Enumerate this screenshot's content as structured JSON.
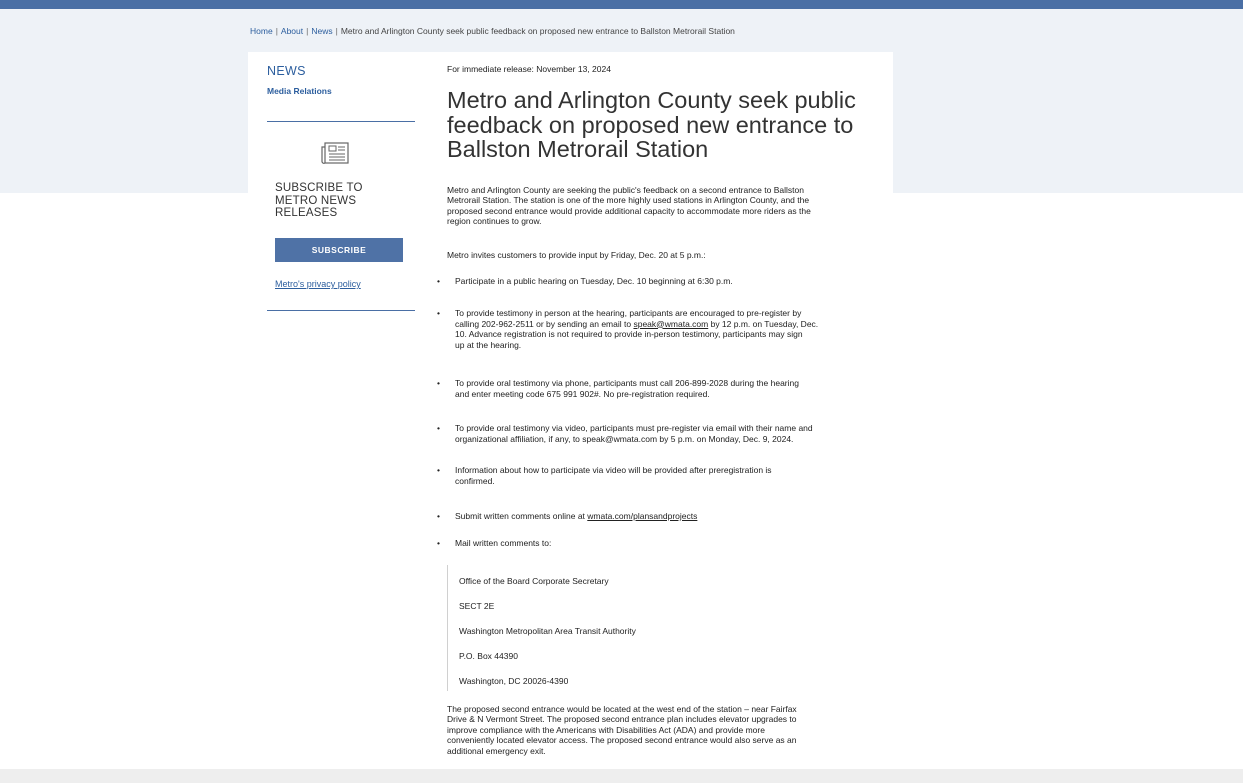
{
  "breadcrumb": {
    "home": "Home",
    "about": "About",
    "news": "News",
    "current": "Metro and Arlington County seek public feedback on proposed new entrance to Ballston Metrorail Station",
    "separator": "|"
  },
  "sidebar": {
    "title": "NEWS",
    "link": "Media Relations",
    "subscribe_lines": [
      "SUBSCRIBE TO",
      "METRO NEWS",
      "RELEASES"
    ],
    "subscribe_button": "SUBSCRIBE",
    "privacy_link": "Metro's privacy policy"
  },
  "article": {
    "release_date": "For immediate release: November 13, 2024",
    "headline_lines": [
      "Metro and Arlington County seek public",
      "feedback on proposed new entrance to",
      "Ballston Metrorail Station"
    ],
    "lead_lines": [
      "Metro and Arlington County are seeking the public's feedback on a second entrance to Ballston",
      "Metrorail Station. The station is one of the more highly used stations in Arlington County, and the",
      "proposed second entrance would provide additional capacity to accommodate more riders as the",
      "region continues to grow."
    ],
    "invite": "Metro invites customers to provide input by Friday, Dec. 20 at 5 p.m.:",
    "bullets": [
      {
        "lines": [
          "Participate in a public hearing on Tuesday, Dec. 10 beginning at 6:30 p.m."
        ]
      },
      {
        "pre": "To provide testimony in person at the hearing, participants are encouraged to pre-register by",
        "line2_pre": "calling 202-962-2511 or by sending an email to ",
        "link": "speak@wmata.com",
        "line2_post": " by 12 p.m. on Tuesday, Dec.",
        "rest": [
          "10. Advance registration is not required to provide in-person testimony, participants may sign",
          "up at the hearing."
        ]
      },
      {
        "lines": [
          "To provide oral testimony via phone, participants must call 206-899-2028 during the hearing",
          "and enter meeting code 675 991 902#. No pre-registration required."
        ]
      },
      {
        "lines": [
          "To provide oral testimony via video, participants must pre-register via email with their name and",
          "organizational affiliation, if any, to speak@wmata.com by 5 p.m. on Monday, Dec. 9, 2024."
        ]
      },
      {
        "lines": [
          "Information about how to participate via video will be provided after preregistration is",
          "confirmed."
        ]
      },
      {
        "pre": "Submit written comments online at ",
        "link": "wmata.com/plansandprojects"
      },
      {
        "lines": [
          "Mail written comments to:"
        ]
      }
    ],
    "address": [
      "Office of the Board Corporate Secretary",
      "SECT 2E",
      "Washington Metropolitan Area Transit Authority",
      "P.O. Box 44390",
      "Washington, DC 20026-4390"
    ],
    "closing_lines": [
      "The proposed second entrance would be located at the west end of the station – near Fairfax",
      "Drive & N Vermont Street. The proposed second entrance plan includes elevator upgrades to",
      "improve compliance with the Americans with Disabilities Act (ADA) and provide more",
      "conveniently located elevator access. The proposed second entrance would also serve as an",
      "additional emergency exit."
    ]
  },
  "icons": {
    "news": "newspaper-icon",
    "bullet": "bullet-dot"
  },
  "colors": {
    "accent": "#4a6fa5",
    "link": "#2c5e9e",
    "button": "#4f72a6"
  }
}
